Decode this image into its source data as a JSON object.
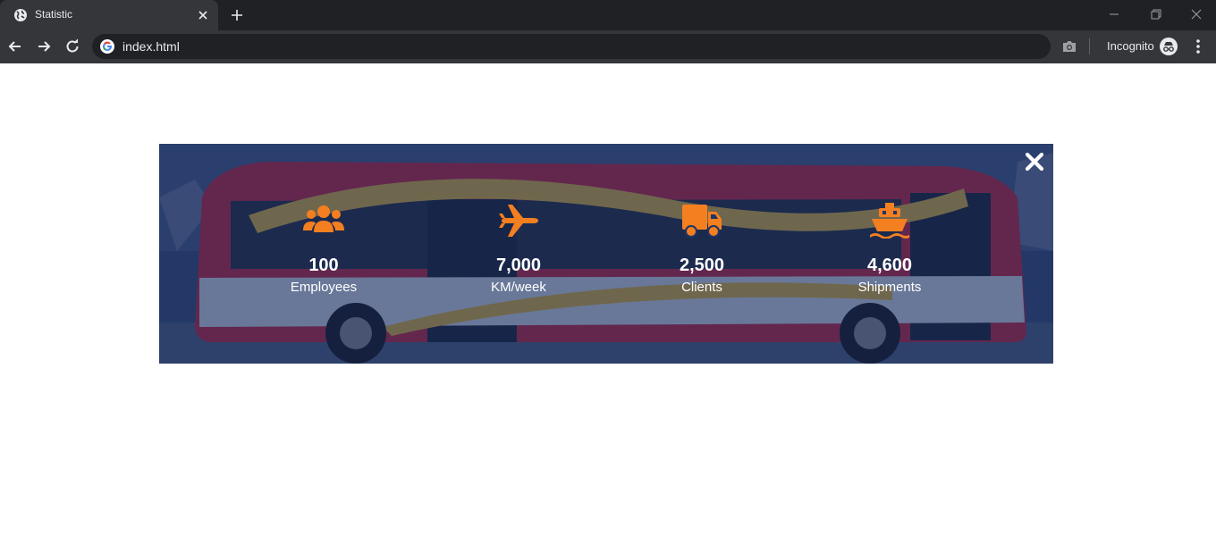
{
  "browser": {
    "tab_title": "Statistic",
    "url": "index.html",
    "incognito_label": "Incognito"
  },
  "colors": {
    "accent": "#f47f20",
    "overlay": "#10265c",
    "chrome_bg": "#202124",
    "toolbar_bg": "#35363a"
  },
  "stats": [
    {
      "icon": "users-icon",
      "value": "100",
      "label": "Employees"
    },
    {
      "icon": "airplane-icon",
      "value": "7,000",
      "label": "KM/week"
    },
    {
      "icon": "truck-icon",
      "value": "2,500",
      "label": "Clients"
    },
    {
      "icon": "ship-icon",
      "value": "4,600",
      "label": "Shipments"
    }
  ]
}
